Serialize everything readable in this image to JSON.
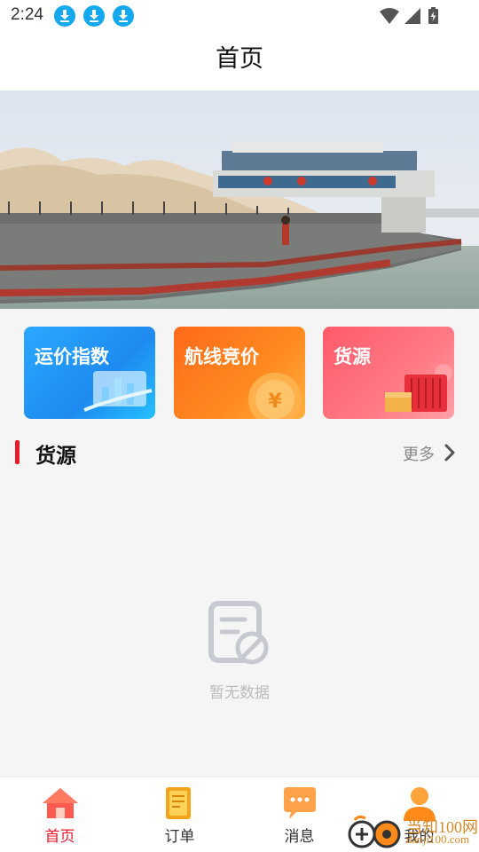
{
  "status_bar": {
    "time": "2:24"
  },
  "header": {
    "title": "首页"
  },
  "banner": {
    "slide_count": 2,
    "active_slide": 1
  },
  "tiles": [
    {
      "label": "运价指数"
    },
    {
      "label": "航线竞价"
    },
    {
      "label": "货源"
    }
  ],
  "section": {
    "title": "货源",
    "more_label": "更多"
  },
  "empty_state": {
    "text": "暂无数据"
  },
  "nav": [
    {
      "label": "首页",
      "icon": "home-icon",
      "active": true
    },
    {
      "label": "订单",
      "icon": "order-icon",
      "active": false
    },
    {
      "label": "消息",
      "icon": "message-icon",
      "active": false
    },
    {
      "label": "我的",
      "icon": "profile-icon",
      "active": false
    }
  ],
  "watermark": {
    "text": "当知100网",
    "sub": "danji100.com"
  },
  "colors": {
    "accent": "#e8192b",
    "dot_active": "#3d7ff0",
    "download_badge": "#14a8ee"
  }
}
